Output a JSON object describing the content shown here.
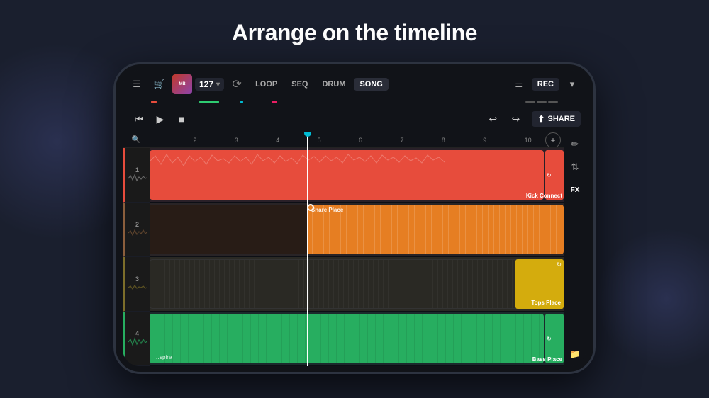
{
  "headline": "Arrange on the timeline",
  "topbar": {
    "bpm": "127",
    "modes": [
      "LOOP",
      "SEQ",
      "DRUM",
      "SONG"
    ],
    "active_mode": "SONG",
    "rec_label": "REC",
    "tune_icon": "⚙"
  },
  "transport": {
    "rewind_icon": "⏮",
    "play_icon": "▶",
    "stop_icon": "■",
    "undo_icon": "↩",
    "redo_icon": "↪",
    "share_label": "SHARE"
  },
  "ruler": {
    "marks": [
      "",
      "2",
      "3",
      "4",
      "5",
      "6",
      "7",
      "8",
      "9",
      "10"
    ]
  },
  "tracks": [
    {
      "num": "1",
      "color": "#e74c3c",
      "clip_label": "Kick Connect",
      "clip_start_pct": 0,
      "clip_end_pct": 100
    },
    {
      "num": "2",
      "color": "#e67e22",
      "clip_label": "Snare Place",
      "clip_start_pct": 0,
      "clip_end_pct": 100
    },
    {
      "num": "3",
      "color": "#d4ac0d",
      "clip_label": "Tops Place",
      "clip_start_pct": 0,
      "clip_end_pct": 100
    },
    {
      "num": "4",
      "color": "#27ae60",
      "clip_label": "Bass Place",
      "clip_start_pct": 0,
      "clip_end_pct": 100
    }
  ],
  "right_panel": {
    "edit_icon": "✏",
    "mixer_icon": "⇅",
    "fx_label": "FX",
    "folder_icon": "📁"
  }
}
